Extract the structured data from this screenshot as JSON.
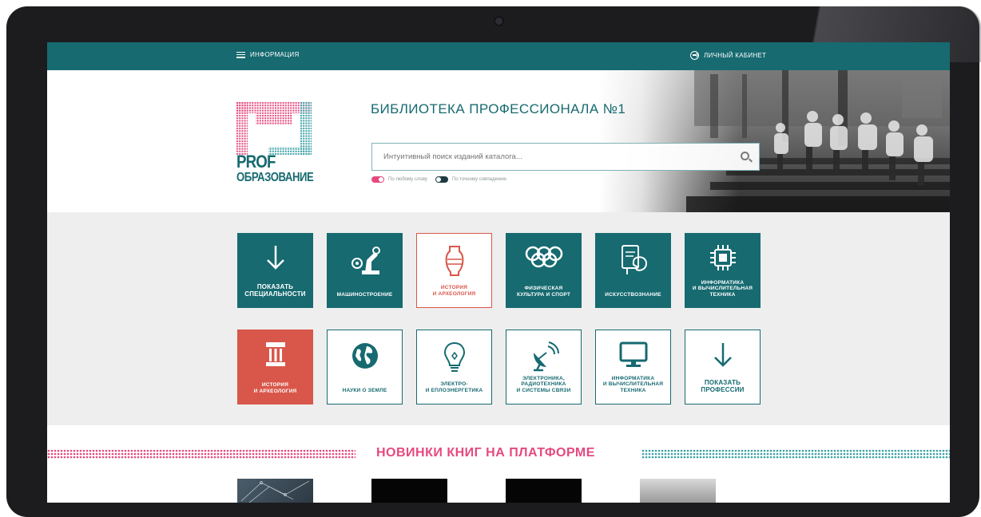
{
  "topbar": {
    "menu_label": "ИНФОРМАЦИЯ",
    "cabinet_label": "ЛИЧНЫЙ КАБИНЕТ"
  },
  "logo": {
    "line1": "PROF",
    "line2": "ОБРАЗОВАНИЕ"
  },
  "header": {
    "title": "БИБЛИОТЕКА ПРОФЕССИОНАЛА №1"
  },
  "search": {
    "placeholder": "Интуитивный поиск изданий каталога..."
  },
  "toggles": [
    {
      "label": "По любому слову",
      "state": "on"
    },
    {
      "label": "По точному совпадению",
      "state": "off"
    }
  ],
  "tiles_row1": [
    {
      "label": "ПОКАЗАТЬ\nСПЕЦИАЛЬНОСТИ",
      "icon": "arrow-down-icon",
      "style": "filled-teal"
    },
    {
      "label": "МАШИНОСТРОЕНИЕ",
      "icon": "robot-arm-icon",
      "style": "filled-teal"
    },
    {
      "label": "ИСТОРИЯ\nИ АРХЕОЛОГИЯ",
      "icon": "amphora-icon",
      "style": "outline-red"
    },
    {
      "label": "ФИЗИЧЕСКАЯ\nКУЛЬТУРА И СПОРТ",
      "icon": "olympic-rings-icon",
      "style": "filled-teal"
    },
    {
      "label": "ИСКУССТВОЗНАНИЕ",
      "icon": "palette-icon",
      "style": "filled-teal"
    },
    {
      "label": "ИНФОРМАТИКА\nИ ВЫЧИСЛИТЕЛЬНАЯ\nТЕХНИКА",
      "icon": "chip-icon",
      "style": "filled-teal"
    }
  ],
  "tiles_row2": [
    {
      "label": "ИСТОРИЯ\nИ АРХЕОЛОГИЯ",
      "icon": "column-icon",
      "style": "filled-red"
    },
    {
      "label": "НАУКИ О ЗЕМЛЕ",
      "icon": "globe-icon",
      "style": "outline-teal"
    },
    {
      "label": "ЭЛЕКТРО-\nИ ЕПЛОЭНЕРГЕТИКА",
      "icon": "lightbulb-icon",
      "style": "outline-teal"
    },
    {
      "label": "ЭЛЕКТРОНИКА,\nРАДИОТЕХНИКА\nИ СИСТЕМЫ СВЯЗИ",
      "icon": "satellite-dish-icon",
      "style": "outline-teal"
    },
    {
      "label": "ИНФОРМАТИКА\nИ ВЫЧИСЛИТЕЛЬНАЯ\nТЕХНИКА",
      "icon": "monitor-icon",
      "style": "outline-teal"
    },
    {
      "label": "ПОКАЗАТЬ\nПРОФЕССИИ",
      "icon": "arrow-down-icon",
      "style": "outline-teal"
    }
  ],
  "new_books": {
    "title": "НОВИНКИ КНИГ НА ПЛАТФОРМЕ"
  },
  "colors": {
    "teal": "#166a70",
    "red": "#d9574a",
    "pink": "#e5497f",
    "tile_bg": "#eeeeee"
  }
}
